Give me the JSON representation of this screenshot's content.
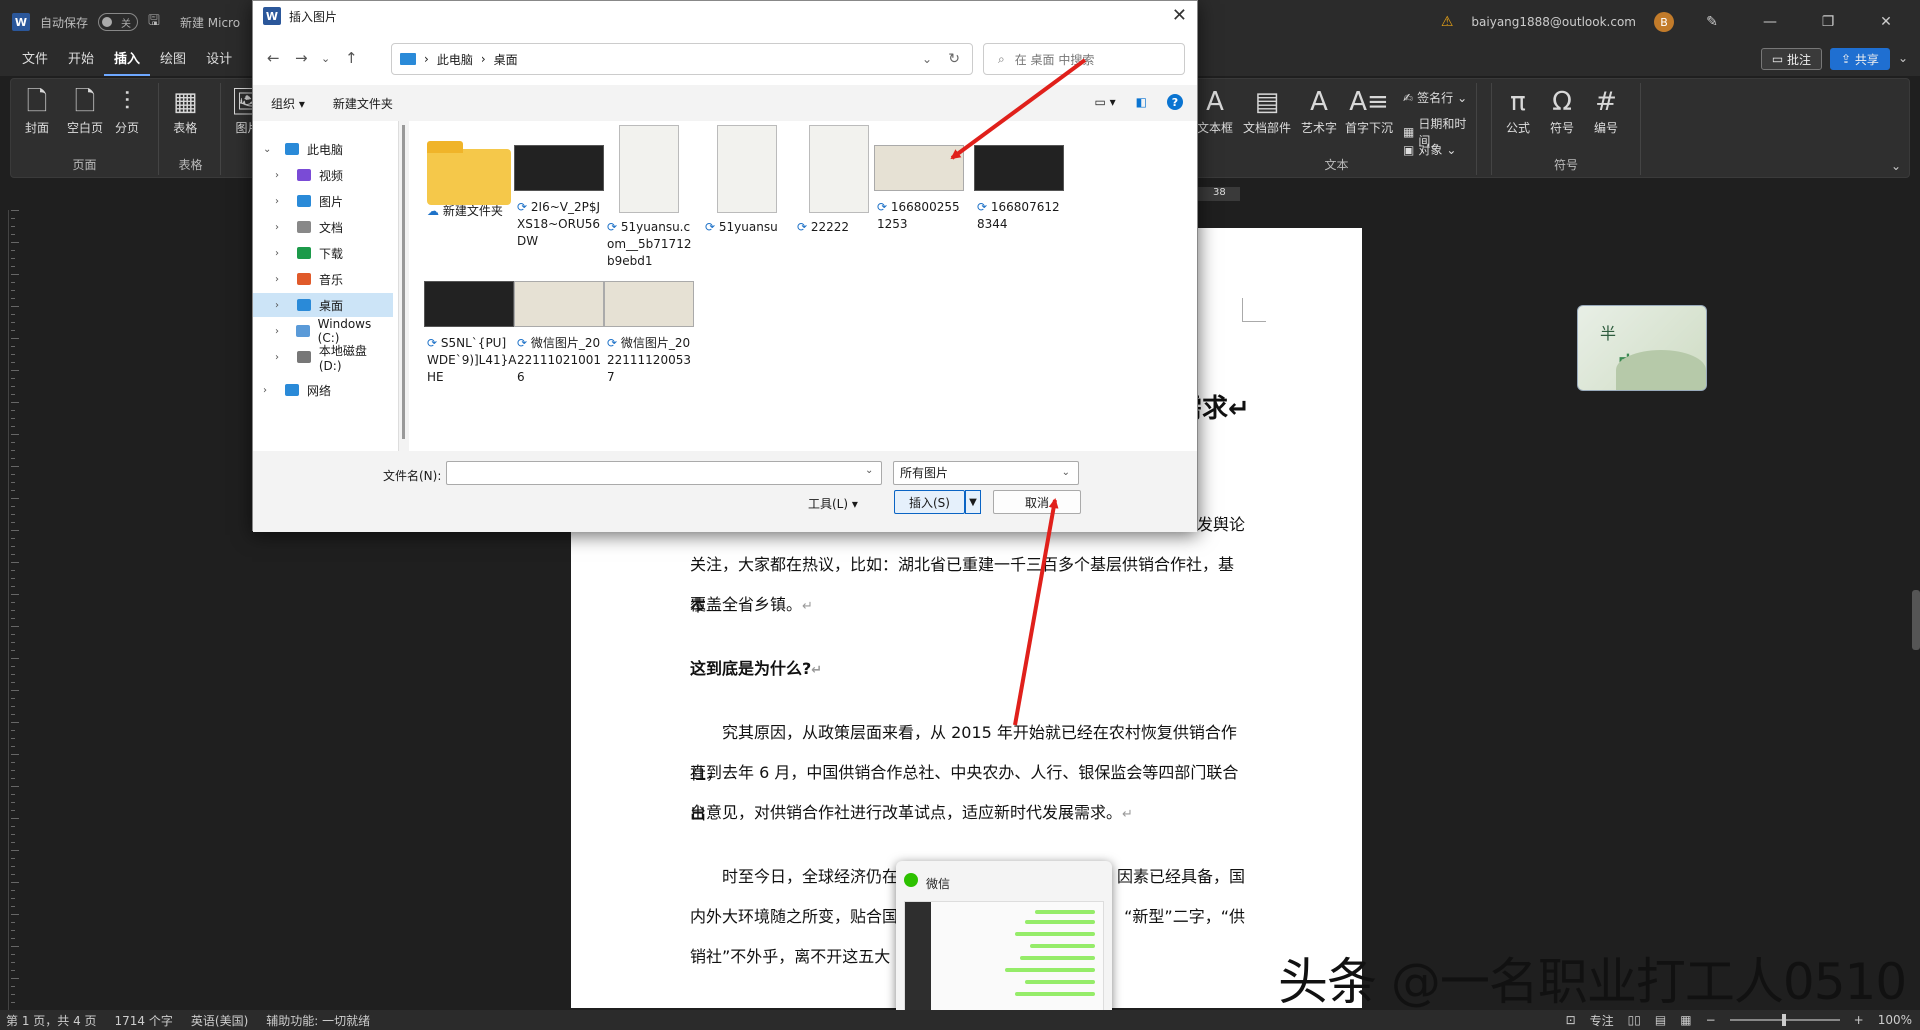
{
  "titlebar": {
    "autosave_label": "自动保存",
    "autosave_state": "关",
    "doc_name": "新建 Micro",
    "account": "baiyang1888@outlook.com",
    "account_initial": "B"
  },
  "menu": {
    "tabs": [
      "文件",
      "开始",
      "插入",
      "绘图",
      "设计"
    ],
    "active_tab": "插入",
    "comments_label": "批注",
    "share_label": "共享"
  },
  "ribbon": {
    "pages_group": {
      "caption": "页面",
      "cover": "封面",
      "blank": "空白页",
      "break": "分页"
    },
    "table_group": {
      "caption": "表格",
      "table": "表格"
    },
    "picture": "图片",
    "text_group": {
      "caption": "文本",
      "textbox": "文本框",
      "docparts": "文档部件",
      "wordart": "艺术字",
      "dropcap": "首字下沉",
      "signature": "签名行",
      "datetime": "日期和时间",
      "object": "对象"
    },
    "symbol_group": {
      "caption": "符号",
      "equation": "公式",
      "symbol": "符号",
      "number": "编号"
    }
  },
  "ruler": {
    "mark": "38"
  },
  "dialog": {
    "title": "插入图片",
    "breadcrumb": [
      "此电脑",
      "桌面"
    ],
    "search_placeholder": "在 桌面 中搜索",
    "organize": "组织",
    "new_folder": "新建文件夹",
    "nav": [
      {
        "label": "此电脑",
        "color": "#2a8ad8"
      },
      {
        "label": "视频",
        "color": "#7a4bd6"
      },
      {
        "label": "图片",
        "color": "#2a8ad8"
      },
      {
        "label": "文档",
        "color": "#888888"
      },
      {
        "label": "下载",
        "color": "#1c9a4a"
      },
      {
        "label": "音乐",
        "color": "#e05a2a"
      },
      {
        "label": "桌面",
        "color": "#2a8ad8"
      },
      {
        "label": "Windows (C:)",
        "color": "#5a9ad8"
      },
      {
        "label": "本地磁盘 (D:)",
        "color": "#777777"
      },
      {
        "label": "网络",
        "color": "#2a8ad8"
      }
    ],
    "files": [
      {
        "name": "新建文件夹",
        "kind": "folder"
      },
      {
        "name": "2I6~V_2P$JXS18~ORU56DW",
        "kind": "dark"
      },
      {
        "name": "51yuansu.com__5b71712b9ebd1",
        "kind": "doc"
      },
      {
        "name": "51yuansu",
        "kind": "doc"
      },
      {
        "name": "22222",
        "kind": "doc"
      },
      {
        "name": "1668002551253",
        "kind": "paper"
      },
      {
        "name": "1668076128344",
        "kind": "dark"
      },
      {
        "name": "S5NL`{PU]WDE`9)]L41}AHE",
        "kind": "dark"
      },
      {
        "name": "微信图片_20221110210016",
        "kind": "paper"
      },
      {
        "name": "微信图片_20221111200537",
        "kind": "paper"
      }
    ],
    "filename_label": "文件名(N):",
    "filename_value": "",
    "filetype": "所有图片",
    "tools": "工具(L)",
    "insert": "插入(S)",
    "cancel": "取消"
  },
  "document": {
    "heading_fragment": "需求",
    "p1_fragment": "引发舆论",
    "p1b": "关注，大家都在热议，比如：湖北省已重建一千三百多个基层供销合作社，基本",
    "p1c": "覆盖全省乡镇。",
    "h2": "这到底是为什么?",
    "p2a": "究其原因，从政策层面来看，从 2015 年开始就已经在农村恢复供销合作社，",
    "p2b": "直到去年 6 月，中国供销合作总社、中央农办、人行、银保监会等四部门联合出",
    "p2c": "台意见，对供销合作社进行改革试点，适应新时代发展需求。",
    "p3a": "时至今日，全球经济仍在",
    "p3a_end": "因素已经具备，国",
    "p3b": "内外大环境随之所变，贴合国",
    "p3b_end": "“新型”二字，“供",
    "p3c": "销社”不外乎，离不开这五大",
    "para_mark": "↵"
  },
  "float_image": {
    "text1": "半",
    "text2": "中"
  },
  "wechat_preview": {
    "title": "微信"
  },
  "watermark": "头条 @一名职业打工人0510",
  "statusbar": {
    "page": "第 1 页，共 4 页",
    "words": "1714 个字",
    "language": "英语(美国)",
    "accessibility": "辅助功能: 一切就绪",
    "focus": "专注",
    "zoom": "100%"
  },
  "annotation_color": "#e0201b"
}
